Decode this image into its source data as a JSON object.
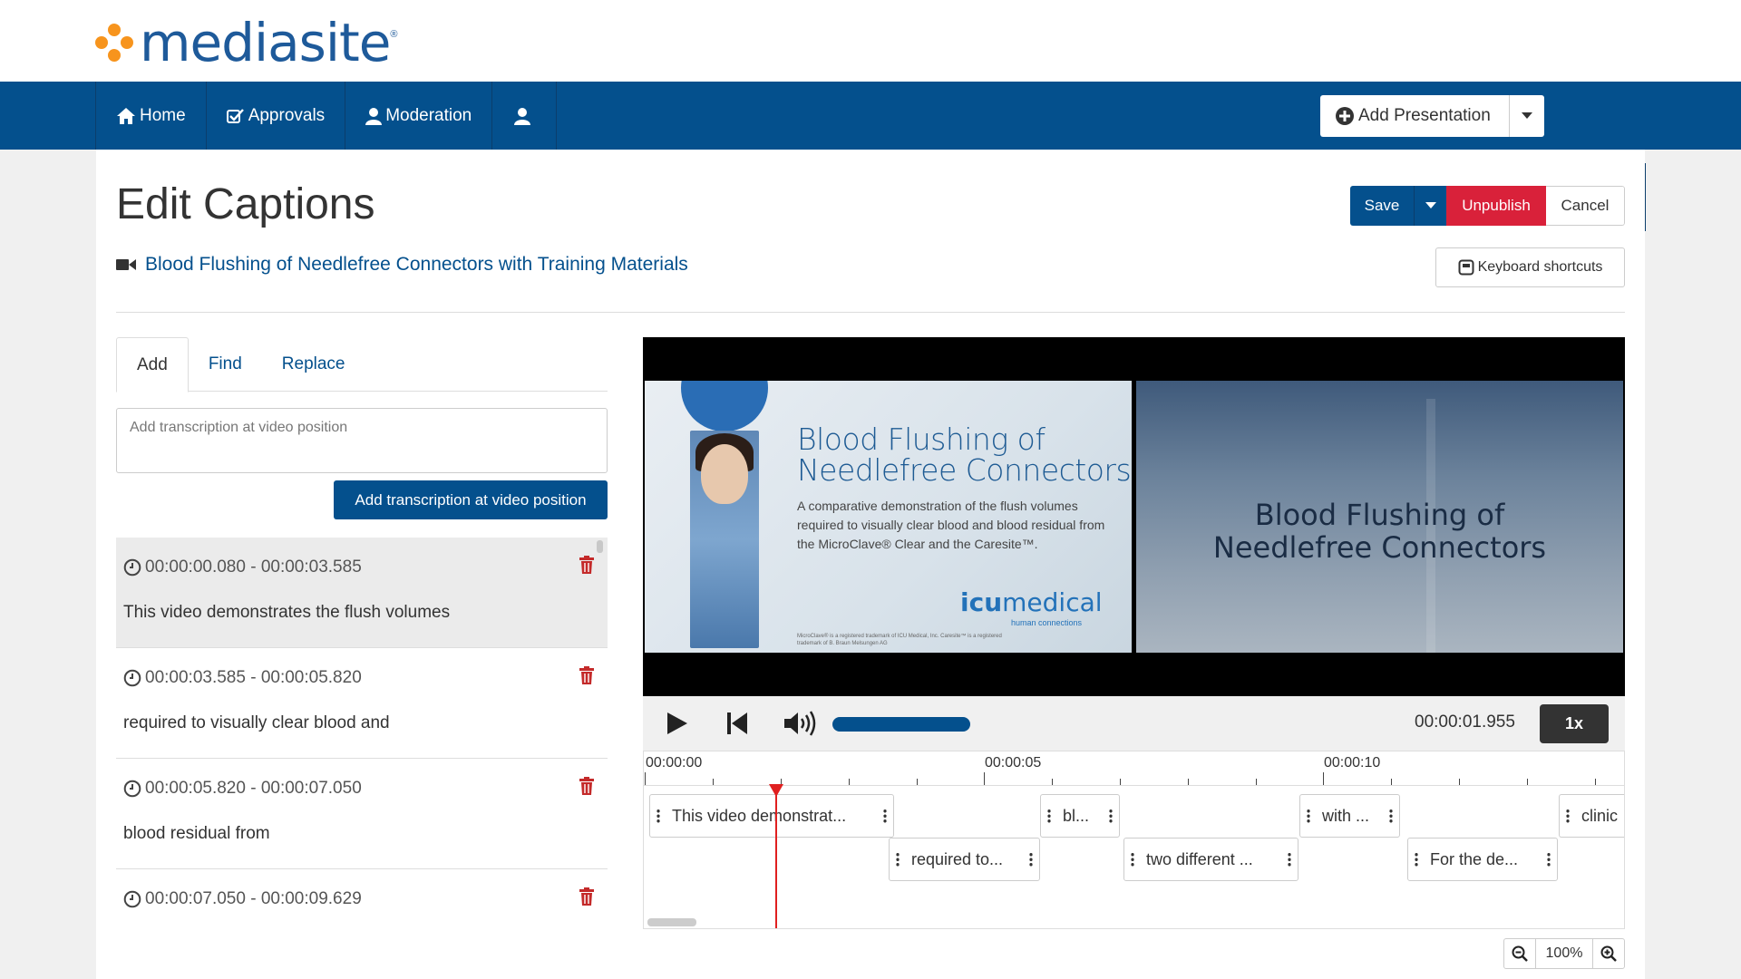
{
  "brand": {
    "logo_text": "mediasite",
    "logo_registered": "®",
    "logo_dot_color": "#f7941d",
    "logo_text_color": "#1e5a9a"
  },
  "colors": {
    "nav": "#04508d",
    "unpublish": "#d9213a",
    "playhead": "#e02020"
  },
  "nav": {
    "items": [
      {
        "label": "Home",
        "icon": "home-icon"
      },
      {
        "label": "Approvals",
        "icon": "check-square-icon"
      },
      {
        "label": "Moderation",
        "icon": "user-icon"
      },
      {
        "label": "",
        "icon": "user-icon"
      }
    ],
    "add_presentation": "Add Presentation",
    "search_icon": "search-icon"
  },
  "page": {
    "title": "Edit Captions",
    "presentation_title": "Blood Flushing of Needlefree Connectors with Training Materials",
    "save": "Save",
    "unpublish": "Unpublish",
    "cancel": "Cancel",
    "keyboard_shortcuts": "Keyboard shortcuts"
  },
  "left": {
    "tabs": [
      "Add",
      "Find",
      "Replace"
    ],
    "active_tab": "Add",
    "textarea_placeholder": "Add transcription at video position",
    "add_button": "Add transcription at video position",
    "captions": [
      {
        "time": "00:00:00.080 - 00:00:03.585",
        "text": "This video demonstrates the flush volumes",
        "selected": true
      },
      {
        "time": "00:00:03.585 - 00:00:05.820",
        "text": "required to visually clear blood and"
      },
      {
        "time": "00:00:05.820 - 00:00:07.050",
        "text": "blood residual from"
      },
      {
        "time": "00:00:07.050 - 00:00:09.629",
        "text": ""
      }
    ]
  },
  "slides": {
    "left": {
      "title_line1": "Blood Flushing of",
      "title_line2": "Needlefree Connectors",
      "body": "A comparative demonstration of the flush volumes required to visually clear blood and blood residual from the MicroClave® Clear and the Caresite™.",
      "logo_bold": "icu",
      "logo_light": "medical",
      "logo_sub": "human connections",
      "fine_print": "MicroClave® is a registered trademark of ICU Medical, Inc. Caresite™ is a registered trademark of B. Braun Melsungen AG"
    },
    "right": {
      "title_line1": "Blood Flushing of",
      "title_line2": "Needlefree Connectors"
    }
  },
  "player": {
    "current_time": "00:00:01.955",
    "speed": "1x",
    "progress_fraction": 0.14
  },
  "timeline": {
    "labels": [
      "00:00:00",
      "00:00:05",
      "00:00:10"
    ],
    "chips_row1": [
      "This video demonstrat...",
      "bl...",
      "with ...",
      "clinic"
    ],
    "chips_row2": [
      "required to...",
      "two different ...",
      "For the de..."
    ]
  },
  "zoom": {
    "value": "100%"
  }
}
